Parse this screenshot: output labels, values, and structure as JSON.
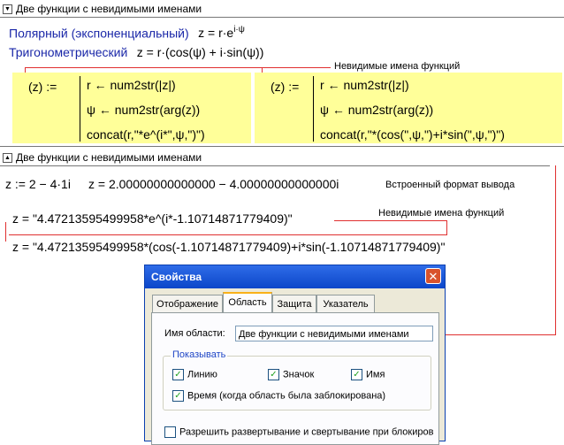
{
  "region1": {
    "header_toggle_glyph": "▼",
    "header_title": "Две функции с невидимыми именами",
    "polar_label": "Полярный (экспоненциальный)",
    "polar_formula": "z = r·e",
    "polar_exp": "i·ψ",
    "trig_label": "Тригонометрический",
    "trig_formula": "z = r·(cos(ψ) + i·sin(ψ))",
    "annotation": "Невидимые имена функций",
    "func1": {
      "head": "(z) :=",
      "line1": "r ← num2str(|z|)",
      "line2": "ψ ← num2str(arg(z))",
      "line3": "concat(r,\"*e^(i*\",ψ,\")\")"
    },
    "func2": {
      "head": "(z) :=",
      "line1": "r ← num2str(|z|)",
      "line2": "ψ ← num2str(arg(z))",
      "line3": "concat(r,\"*(cos(\",ψ,\")+i*sin(\",ψ,\")\")"
    }
  },
  "region2": {
    "header_toggle_glyph": "▲",
    "header_title": "Две функции с невидимыми именами"
  },
  "workspace": {
    "assign": "z := 2 − 4·1i",
    "eval": "z = 2.00000000000000 − 4.00000000000000i",
    "builtin_note": "Встроенный формат вывода",
    "annotation": "Невидимые имена функций",
    "result1": "z = \"4.47213595499958*e^(i*-1.10714871779409)\"",
    "result2": "z = \"4.47213595499958*(cos(-1.10714871779409)+i*sin(-1.10714871779409)\""
  },
  "dialog": {
    "title": "Свойства",
    "close_glyph": "✕",
    "tabs": [
      "Отображение",
      "Область",
      "Защита",
      "Указатель"
    ],
    "active_tab": "Область",
    "name_label": "Имя области:",
    "name_value": "Две функции с невидимыми именами",
    "group_label": "Показывать",
    "checkbox_line": "Линию",
    "checkbox_icon": "Значок",
    "checkbox_name": "Имя",
    "checkbox_time": "Время (когда область была заблокирована)",
    "checkbox_allow": "Разрешить развертывание и свертывание при блокиров",
    "check_glyph": "✓"
  },
  "colors": {
    "highlight": "#ffff99",
    "link_line": "#e03030",
    "title_blue": "#1a27a8"
  }
}
